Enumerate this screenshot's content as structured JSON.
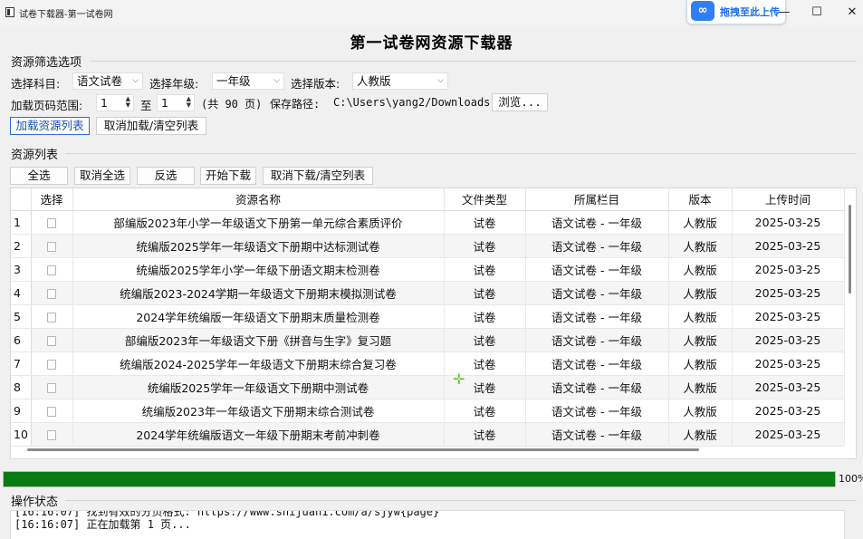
{
  "window": {
    "title": "试卷下载器-第一试卷网",
    "upload_label": "拖拽至此上传",
    "minimize": "—",
    "maximize": "☐",
    "close": "✕"
  },
  "heading": "第一试卷网资源下载器",
  "filter": {
    "section_title": "资源筛选选项",
    "subject_label": "选择科目:",
    "subject_value": "语文试卷",
    "grade_label": "选择年级:",
    "grade_value": "一年级",
    "version_label": "选择版本:",
    "version_value": "人教版",
    "range_label": "加载页码范围:",
    "range_from": "1",
    "range_to_label": "至",
    "range_to": "1",
    "total_pages": "(共 90 页)",
    "save_label": "保存路径:",
    "save_path": "C:\\Users\\yang2/Downloads",
    "browse_button": "浏览...",
    "load_button": "加载资源列表",
    "cancel_load_button": "取消加载/清空列表"
  },
  "list": {
    "section_title": "资源列表",
    "select_all": "全选",
    "deselect_all": "取消全选",
    "invert": "反选",
    "start_download": "开始下载",
    "cancel_download": "取消下载/清空列表",
    "columns": [
      "选择",
      "资源名称",
      "文件类型",
      "所属栏目",
      "版本",
      "上传时间"
    ],
    "rows": [
      {
        "num": "1",
        "name": "部编版2023年小学一年级语文下册第一单元综合素质评价",
        "type": "试卷",
        "category": "语文试卷 - 一年级",
        "version": "人教版",
        "date": "2025-03-25"
      },
      {
        "num": "2",
        "name": "统编版2025学年一年级语文下册期中达标测试卷",
        "type": "试卷",
        "category": "语文试卷 - 一年级",
        "version": "人教版",
        "date": "2025-03-25"
      },
      {
        "num": "3",
        "name": "统编版2025学年小学一年级下册语文期末检测卷",
        "type": "试卷",
        "category": "语文试卷 - 一年级",
        "version": "人教版",
        "date": "2025-03-25"
      },
      {
        "num": "4",
        "name": "统编版2023-2024学期一年级语文下册期末模拟测试卷",
        "type": "试卷",
        "category": "语文试卷 - 一年级",
        "version": "人教版",
        "date": "2025-03-25"
      },
      {
        "num": "5",
        "name": "2024学年统编版一年级语文下册期末质量检测卷",
        "type": "试卷",
        "category": "语文试卷 - 一年级",
        "version": "人教版",
        "date": "2025-03-25"
      },
      {
        "num": "6",
        "name": "部编版2023年一年级语文下册《拼音与生字》复习题",
        "type": "试卷",
        "category": "语文试卷 - 一年级",
        "version": "人教版",
        "date": "2025-03-25"
      },
      {
        "num": "7",
        "name": "统编版2024-2025学年一年级语文下册期末综合复习卷",
        "type": "试卷",
        "category": "语文试卷 - 一年级",
        "version": "人教版",
        "date": "2025-03-25"
      },
      {
        "num": "8",
        "name": "统编版2025学年一年级语文下册期中测试卷",
        "type": "试卷",
        "category": "语文试卷 - 一年级",
        "version": "人教版",
        "date": "2025-03-25"
      },
      {
        "num": "9",
        "name": "统编版2023年一年级语文下册期末综合测试卷",
        "type": "试卷",
        "category": "语文试卷 - 一年级",
        "version": "人教版",
        "date": "2025-03-25"
      },
      {
        "num": "10",
        "name": "2024学年统编版语文一年级下册期末考前冲刺卷",
        "type": "试卷",
        "category": "语文试卷 - 一年级",
        "version": "人教版",
        "date": "2025-03-25"
      }
    ]
  },
  "progress": {
    "percent": 100,
    "text": "100%",
    "color": "#0a7a12"
  },
  "log": {
    "section_title": "操作状态",
    "lines": [
      "[16:16:07] 找到有效的分页格式: https://www.shijuan1.com/a/sjyw{page}",
      "[16:16:07] 正在加载第 1 页..."
    ]
  }
}
